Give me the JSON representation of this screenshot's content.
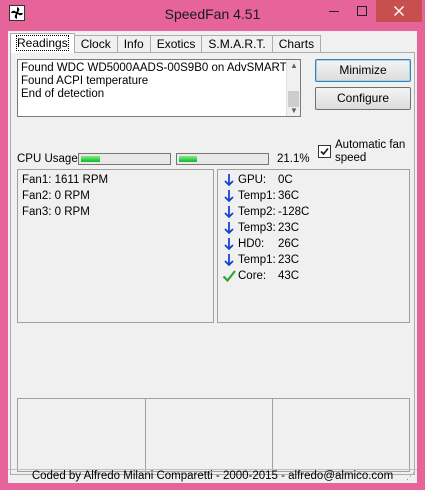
{
  "window": {
    "title": "SpeedFan 4.51",
    "icons": {
      "app": "fan-icon",
      "minimize": "minimize-icon",
      "maximize": "maximize-icon",
      "close": "close-icon"
    }
  },
  "tabs": [
    {
      "label": "Readings",
      "active": true
    },
    {
      "label": "Clock",
      "active": false
    },
    {
      "label": "Info",
      "active": false
    },
    {
      "label": "Exotics",
      "active": false
    },
    {
      "label": "S.M.A.R.T.",
      "active": false
    },
    {
      "label": "Charts",
      "active": false
    }
  ],
  "log": {
    "lines": [
      "Found WDC WD5000AADS-00S9B0 on AdvSMART",
      "Found ACPI temperature",
      "End of detection"
    ]
  },
  "buttons": {
    "minimize": "Minimize",
    "configure": "Configure"
  },
  "auto_fan": {
    "label": "Automatic fan speed",
    "checked": true
  },
  "cpu": {
    "label": "CPU Usage",
    "percent_text": "21.1%",
    "core1_fraction": 0.22,
    "core2_fraction": 0.21
  },
  "fans": [
    {
      "name": "Fan1:",
      "value": "1611 RPM"
    },
    {
      "name": "Fan2:",
      "value": "0 RPM"
    },
    {
      "name": "Fan3:",
      "value": "0 RPM"
    }
  ],
  "temps": [
    {
      "name": "GPU:",
      "value": "0C",
      "status": "arrow-down-icon"
    },
    {
      "name": "Temp1:",
      "value": "36C",
      "status": "arrow-down-icon"
    },
    {
      "name": "Temp2:",
      "value": "-128C",
      "status": "arrow-down-icon"
    },
    {
      "name": "Temp3:",
      "value": "23C",
      "status": "arrow-down-icon"
    },
    {
      "name": "HD0:",
      "value": "26C",
      "status": "arrow-down-icon"
    },
    {
      "name": "Temp1:",
      "value": "23C",
      "status": "arrow-down-icon"
    },
    {
      "name": "Core:",
      "value": "43C",
      "status": "check-icon"
    }
  ],
  "footer": {
    "credits": "Coded by Alfredo Milani Comparetti - 2000-2015 - alfredo@almico.com"
  },
  "colors": {
    "frame": "#e6649a",
    "close_button": "#c7504f",
    "arrow_blue": "#1e3fd6",
    "check_green": "#2ea52e",
    "bar_green": "#0fb72f"
  }
}
